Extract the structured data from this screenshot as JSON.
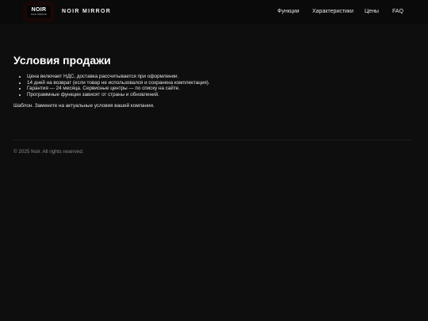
{
  "header": {
    "logo": {
      "main": "NOIR",
      "sub": "NOIR MIRROR"
    },
    "brand": "NOIR MIRROR",
    "nav": [
      "Функции",
      "Характеристики",
      "Цены",
      "FAQ"
    ]
  },
  "main": {
    "title": "Условия продажи",
    "terms": [
      "Цена включает НДС, доставка рассчитывается при оформлении.",
      "14 дней на возврат (если товар не использовался и сохранена комплектация).",
      "Гарантия — 24 месяца. Сервисные центры — по списку на сайте.",
      "Программные функции зависят от страны и обновлений."
    ],
    "note": "Шаблон. Замените на актуальные условия вашей компании."
  },
  "footer": {
    "copyright": "© 2025 Noir. All rights reserved."
  },
  "colors": {
    "background": "#0e0e0e",
    "text": "#e8e8e8",
    "muted": "#8a8a8a",
    "logo_glow": "#5a0000"
  }
}
